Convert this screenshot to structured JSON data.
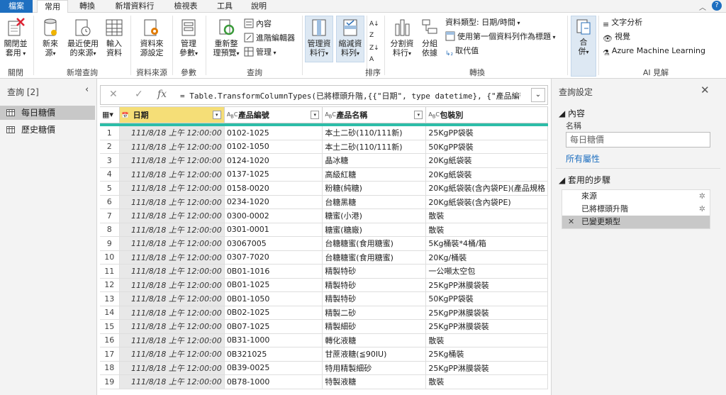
{
  "tabs": [
    "檔案",
    "常用",
    "轉換",
    "新增資料行",
    "檢視表",
    "工具",
    "說明"
  ],
  "ribbon": {
    "close_apply": "關閉並\n套用",
    "close_group": "關閉",
    "new_source": "新來\n源",
    "recent_sources": "最近使用\n的來源",
    "enter_data": "輸入\n資料",
    "new_query_group": "新增查詢",
    "source_settings": "資料來\n源設定",
    "source_group": "資料來源",
    "manage_params": "管理\n參數",
    "params_group": "參數",
    "refresh_preview": "重新整\n理預覽",
    "properties": "內容",
    "advanced_editor": "進階編輯器",
    "manage": "管理",
    "query_group": "查詢",
    "manage_columns": "管理資\n料行",
    "reduce_rows": "縮減資\n料列",
    "sort_group": "排序",
    "split_column": "分割資\n料行",
    "group_by": "分組\n依據",
    "data_type": "資料類型: 日期/時間",
    "use_first_row": "使用第一個資料列作為標題",
    "replace_values": "取代值",
    "transform_group": "轉換",
    "combine": "合\n併",
    "text_analytics": "文字分析",
    "vision": "視覺",
    "azure_ml": "Azure Machine Learning",
    "ai_group": "AI 見解"
  },
  "queries": {
    "title": "查詢 [2]",
    "items": [
      "每日糖價",
      "歷史糖價"
    ]
  },
  "formula": "= Table.TransformColumnTypes(已將標頭升階,{{\"日期\", type datetime}, {\"產品編號\",",
  "grid": {
    "columns": [
      {
        "name": "日期",
        "type": "datetime"
      },
      {
        "name": "產品編號",
        "type": "text"
      },
      {
        "name": "產品名稱",
        "type": "text"
      },
      {
        "name": "包裝別",
        "type": "text"
      }
    ],
    "rows": [
      [
        "1",
        "111/8/18 上午 12:00:00",
        "0102-1025",
        "本土二砂(110/111新)",
        "25KgPP袋裝"
      ],
      [
        "2",
        "111/8/18 上午 12:00:00",
        "0102-1050",
        "本土二砂(110/111新)",
        "50KgPP袋裝"
      ],
      [
        "3",
        "111/8/18 上午 12:00:00",
        "0124-1020",
        "晶冰糖",
        "20Kg紙袋裝"
      ],
      [
        "4",
        "111/8/18 上午 12:00:00",
        "0137-1025",
        "高級紅糖",
        "20Kg紙袋裝"
      ],
      [
        "5",
        "111/8/18 上午 12:00:00",
        "0158-0020",
        "粉糖(純糖)",
        "20Kg紙袋裝(含內袋PE)(產品規格"
      ],
      [
        "6",
        "111/8/18 上午 12:00:00",
        "0234-1020",
        "台糖黑糖",
        "20Kg紙袋裝(含內袋PE)"
      ],
      [
        "7",
        "111/8/18 上午 12:00:00",
        "0300-0002",
        "糖蜜(小港)",
        "散裝"
      ],
      [
        "8",
        "111/8/18 上午 12:00:00",
        "0301-0001",
        "糖蜜(糖廠)",
        "散裝"
      ],
      [
        "9",
        "111/8/18 上午 12:00:00",
        "03067005",
        "台糖糖蜜(食用糖蜜)",
        "5Kg桶裝*4桶/箱"
      ],
      [
        "10",
        "111/8/18 上午 12:00:00",
        "0307-7020",
        "台糖糖蜜(食用糖蜜)",
        "20Kg/桶裝"
      ],
      [
        "11",
        "111/8/18 上午 12:00:00",
        "0B01-1016",
        "精製特砂",
        "一公噸太空包"
      ],
      [
        "12",
        "111/8/18 上午 12:00:00",
        "0B01-1025",
        "精製特砂",
        "25KgPP淋膜袋裝"
      ],
      [
        "13",
        "111/8/18 上午 12:00:00",
        "0B01-1050",
        "精製特砂",
        "50KgPP袋裝"
      ],
      [
        "14",
        "111/8/18 上午 12:00:00",
        "0B02-1025",
        "精製二砂",
        "25KgPP淋膜袋裝"
      ],
      [
        "15",
        "111/8/18 上午 12:00:00",
        "0B07-1025",
        "精製細砂",
        "25KgPP淋膜袋裝"
      ],
      [
        "16",
        "111/8/18 上午 12:00:00",
        "0B31-1000",
        "轉化液糖",
        "散裝"
      ],
      [
        "17",
        "111/8/18 上午 12:00:00",
        "0B321025",
        "甘蔗液糖(≦90IU)",
        "25Kg桶裝"
      ],
      [
        "18",
        "111/8/18 上午 12:00:00",
        "0B39-0025",
        "特用精製細砂",
        "25KgPP淋膜袋裝"
      ],
      [
        "19",
        "111/8/18 上午 12:00:00",
        "0B78-1000",
        "特製液糖",
        "散裝"
      ]
    ]
  },
  "settings": {
    "title": "查詢設定",
    "properties_head": "內容",
    "name_label": "名稱",
    "name_value": "每日糖價",
    "all_props": "所有屬性",
    "steps_head": "套用的步驟",
    "steps": [
      "來源",
      "已將標頭升階",
      "已變更類型"
    ]
  },
  "colors": {
    "file_tab": "#1e6fc0",
    "accent": "#2dbda8",
    "selected_col": "#f5de77"
  }
}
